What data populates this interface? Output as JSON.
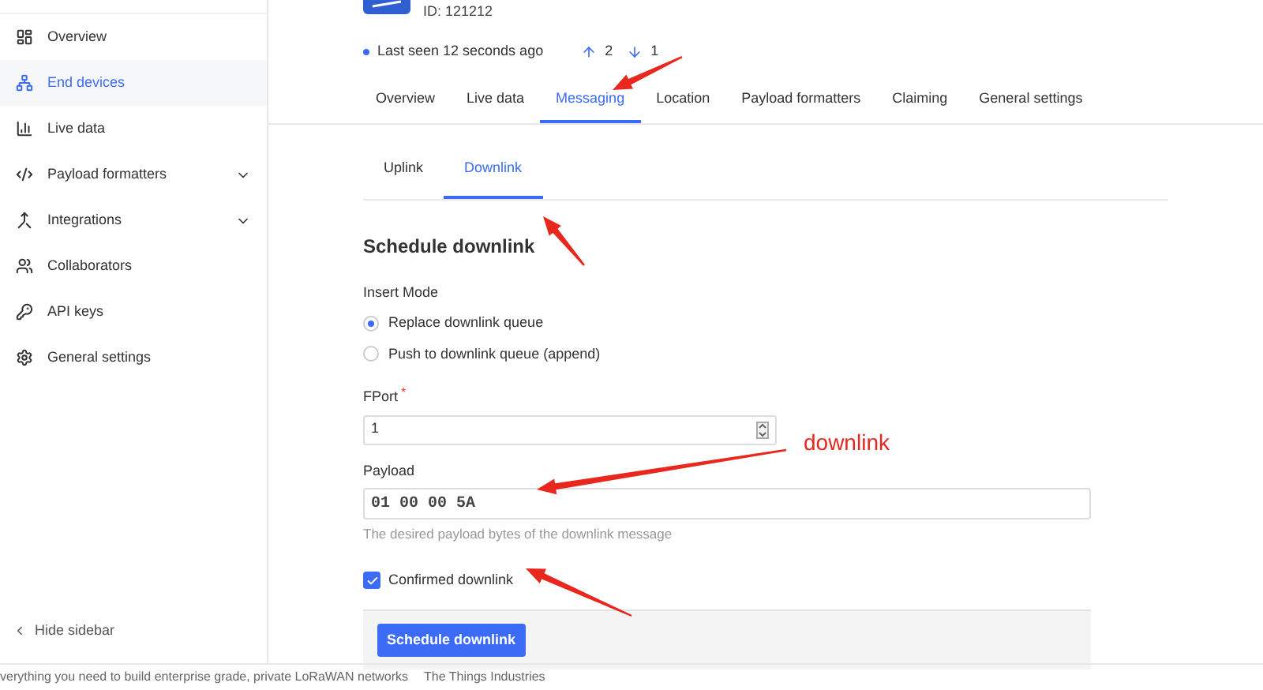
{
  "sidebar": {
    "items": [
      {
        "label": "Overview",
        "selected": false,
        "expandable": false
      },
      {
        "label": "End devices",
        "selected": true,
        "expandable": false
      },
      {
        "label": "Live data",
        "selected": false,
        "expandable": false
      },
      {
        "label": "Payload formatters",
        "selected": false,
        "expandable": true
      },
      {
        "label": "Integrations",
        "selected": false,
        "expandable": true
      },
      {
        "label": "Collaborators",
        "selected": false,
        "expandable": false
      },
      {
        "label": "API keys",
        "selected": false,
        "expandable": false
      },
      {
        "label": "General settings",
        "selected": false,
        "expandable": false
      }
    ],
    "hide_label": "Hide sidebar"
  },
  "device": {
    "id": "ID: 121212",
    "last_seen": "Last seen 12 seconds ago",
    "uplinks": "2",
    "downlinks": "1"
  },
  "tabs": [
    {
      "label": "Overview",
      "selected": false
    },
    {
      "label": "Live data",
      "selected": false
    },
    {
      "label": "Messaging",
      "selected": true
    },
    {
      "label": "Location",
      "selected": false
    },
    {
      "label": "Payload formatters",
      "selected": false
    },
    {
      "label": "Claiming",
      "selected": false
    },
    {
      "label": "General settings",
      "selected": false
    }
  ],
  "subtabs": [
    {
      "label": "Uplink",
      "selected": false
    },
    {
      "label": "Downlink",
      "selected": true
    }
  ],
  "form": {
    "title": "Schedule downlink",
    "insert_mode_label": "Insert Mode",
    "insert_modes": [
      {
        "label": "Replace downlink queue",
        "selected": true
      },
      {
        "label": "Push to downlink queue (append)",
        "selected": false
      }
    ],
    "fport_label": "FPort",
    "fport_required_mark": "*",
    "fport_value": "1",
    "payload_label": "Payload",
    "payload_value": "01 00 00 5A",
    "payload_help": "The desired payload bytes of the downlink message",
    "confirmed_label": "Confirmed downlink",
    "confirmed": true,
    "submit": "Schedule downlink"
  },
  "annotation": "downlink",
  "footer": {
    "tagline": "verything you need to build enterprise grade, private LoRaWAN networks",
    "company": "The Things Industries"
  }
}
